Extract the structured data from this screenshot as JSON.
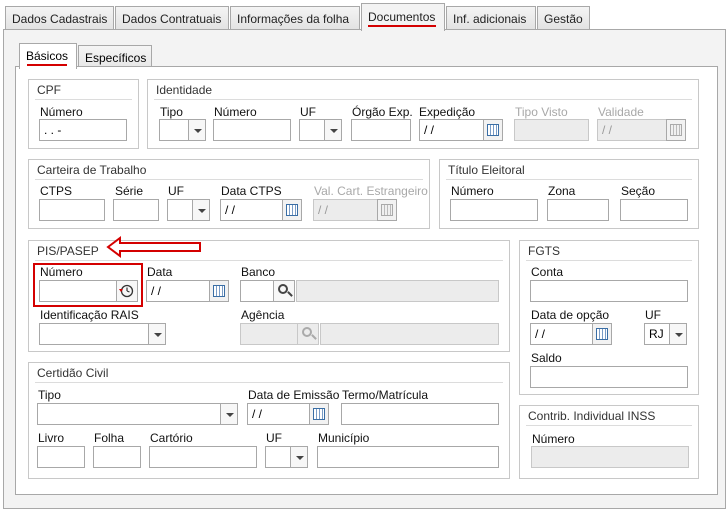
{
  "tabs": [
    {
      "label": "Dados Cadastrais"
    },
    {
      "label": "Dados Contratuais"
    },
    {
      "label": "Informações da folha"
    },
    {
      "label": "Documentos"
    },
    {
      "label": "Inf. adicionais"
    },
    {
      "label": "Gestão"
    }
  ],
  "active_tab": "Documentos",
  "subtabs": [
    {
      "label": "Básicos"
    },
    {
      "label": "Específicos"
    }
  ],
  "cpf": {
    "title": "CPF",
    "numero_label": "Número",
    "numero_value": " .  .  -"
  },
  "identidade": {
    "title": "Identidade",
    "tipo_label": "Tipo",
    "numero_label": "Número",
    "uf_label": "UF",
    "orgao_label": "Órgão Exp.",
    "expedicao_label": "Expedição",
    "expedicao_value": " / /",
    "tipo_visto_label": "Tipo Visto",
    "validade_label": "Validade",
    "validade_value": " / /"
  },
  "carteira": {
    "title": "Carteira de Trabalho",
    "ctps_label": "CTPS",
    "serie_label": "Série",
    "uf_label": "UF",
    "data_ctps_label": "Data CTPS",
    "data_ctps_value": " / /",
    "val_cart_label": "Val. Cart. Estrangeiro",
    "val_cart_value": " / /"
  },
  "titulo_eleitoral": {
    "title": "Título Eleitoral",
    "numero_label": "Número",
    "zona_label": "Zona",
    "secao_label": "Seção"
  },
  "pis": {
    "title": "PIS/PASEP",
    "numero_label": "Número",
    "data_label": "Data",
    "data_value": " / /",
    "banco_label": "Banco",
    "rais_label": "Identificação RAIS",
    "agencia_label": "Agência"
  },
  "fgts": {
    "title": "FGTS",
    "conta_label": "Conta",
    "data_opcao_label": "Data de opção",
    "data_opcao_value": " / /",
    "uf_label": "UF",
    "uf_value": "RJ",
    "saldo_label": "Saldo"
  },
  "certidao": {
    "title": "Certidão Civil",
    "tipo_label": "Tipo",
    "data_emissao_label": "Data de Emissão",
    "data_emissao_value": " / /",
    "termo_label": "Termo/Matrícula",
    "livro_label": "Livro",
    "folha_label": "Folha",
    "cartorio_label": "Cartório",
    "uf_label": "UF",
    "municipio_label": "Município"
  },
  "inss": {
    "title": "Contrib. Individual INSS",
    "numero_label": "Número"
  },
  "colors": {
    "highlight": "#d40000",
    "panel_bg": "#f3f3f3",
    "border": "#a8a8a8"
  }
}
